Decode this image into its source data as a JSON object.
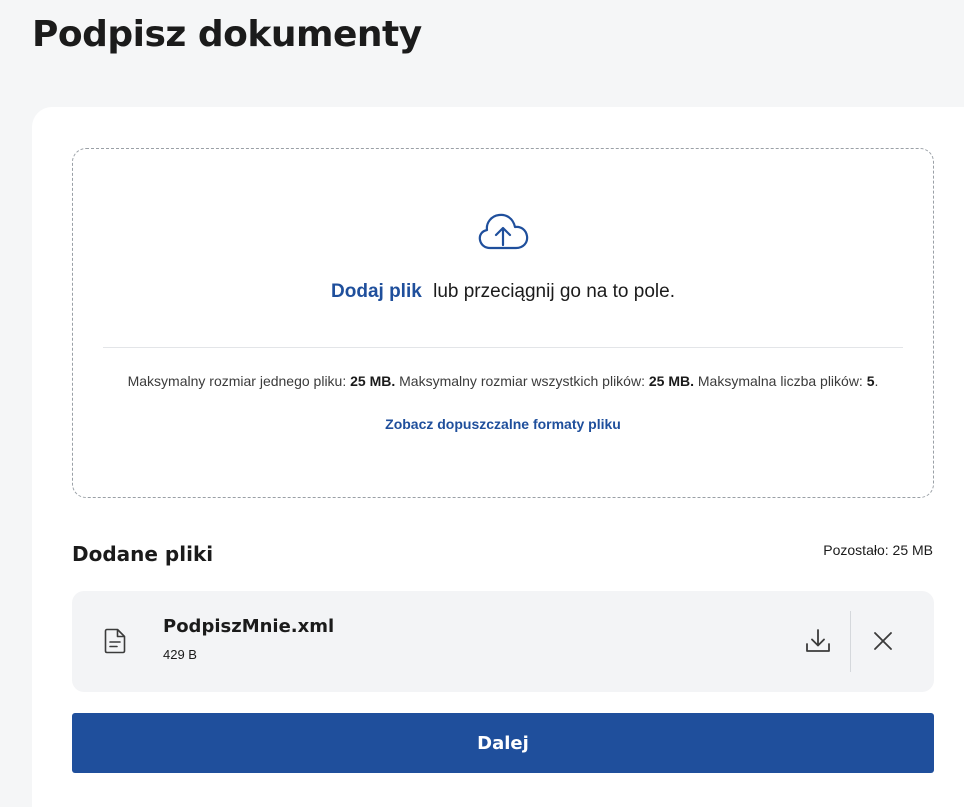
{
  "page": {
    "title": "Podpisz dokumenty"
  },
  "dropzone": {
    "icon": "cloud-upload-icon",
    "add_link": "Dodaj plik",
    "add_text": "lub przeciągnij go na to pole.",
    "limits": {
      "max_single_label": "Maksymalny rozmiar jednego pliku:",
      "max_single_value": "25 MB.",
      "max_total_label": "Maksymalny rozmiar wszystkich plików:",
      "max_total_value": "25 MB.",
      "max_count_label": "Maksymalna liczba plików:",
      "max_count_value": "5",
      "max_count_suffix": "."
    },
    "formats_link": "Zobacz dopuszczalne formaty pliku"
  },
  "files": {
    "heading": "Dodane pliki",
    "remaining": "Pozostało: 25 MB",
    "items": [
      {
        "name": "PodpiszMnie.xml",
        "size": "429 B",
        "icon": "document-icon"
      }
    ]
  },
  "actions": {
    "next_label": "Dalej"
  },
  "colors": {
    "accent": "#1f4f9c",
    "background": "#f5f6f7",
    "file_row": "#f3f4f6"
  }
}
